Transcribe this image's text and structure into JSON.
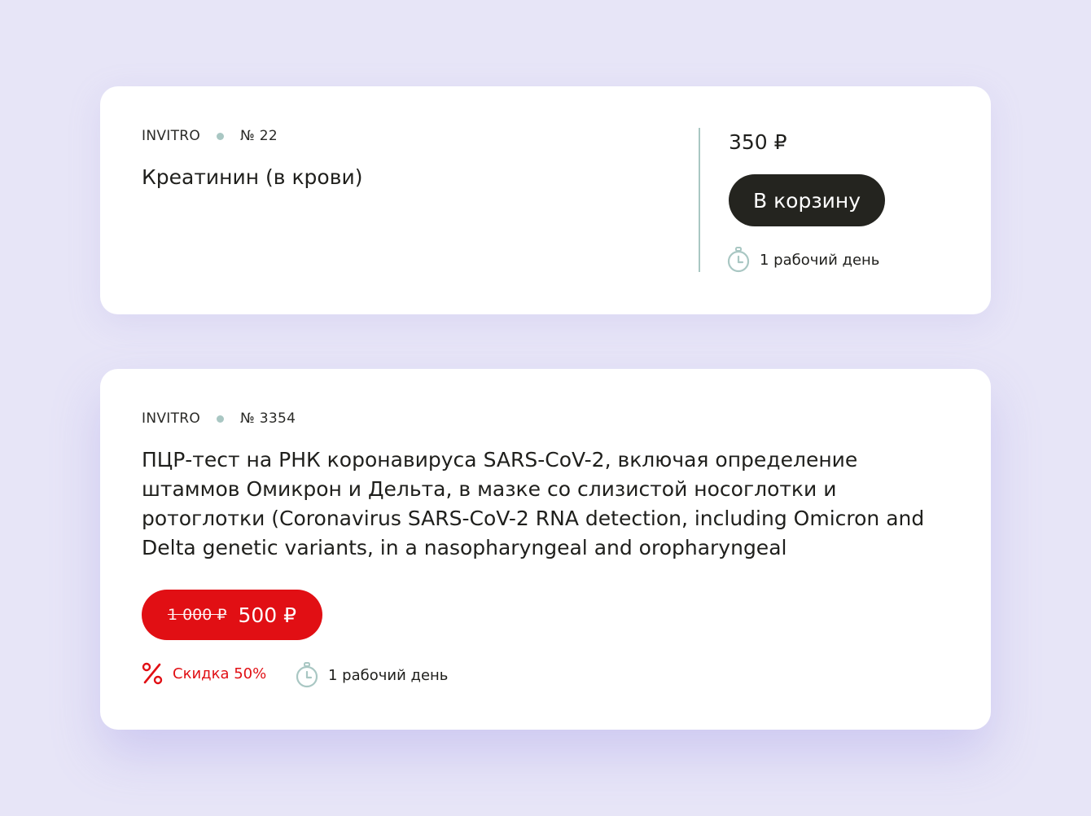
{
  "cards": [
    {
      "lab": "INVITRO",
      "code": "№ 22",
      "title": "Креатинин (в крови)",
      "price": "350 ₽",
      "cart_label": "В корзину",
      "duration": "1 рабочий день"
    },
    {
      "lab": "INVITRO",
      "code": "№ 3354",
      "title": "ПЦР-тест на РНК коронавируса SARS-CoV-2, включая определение штаммов Омикрон и Дельта, в мазке со слизистой носоглотки и ротоглотки (Coronavirus SARS-CoV-2 RNA detection, including Omicron and Delta genetic variants, in a nasopharyngeal and oropharyngeal",
      "old_price": "1 000 ₽",
      "new_price": "500 ₽",
      "discount": "Скидка 50%",
      "duration": "1 рабочий день"
    }
  ],
  "colors": {
    "background": "#e7e5f7",
    "card": "#ffffff",
    "accent_dark": "#24241f",
    "sale_red": "#e10f14",
    "teal_muted": "#a9c7c3"
  },
  "icons": {
    "timer": "stopwatch-icon",
    "discount": "percent-icon"
  }
}
